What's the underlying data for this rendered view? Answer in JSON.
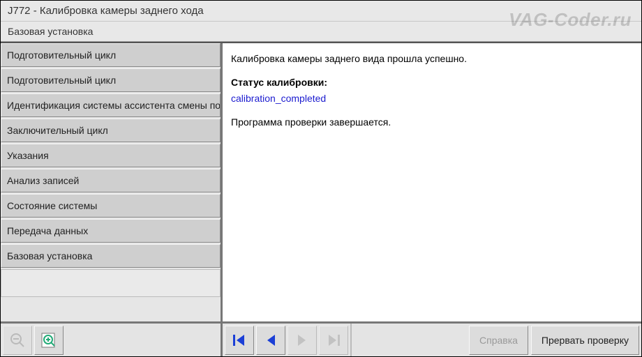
{
  "header": {
    "title": "J772 - Калибровка камеры заднего хода",
    "subtitle": "Базовая установка",
    "watermark": "VAG-Coder.ru"
  },
  "sidebar": {
    "items": [
      "Подготовительный цикл",
      "Подготовительный цикл",
      "Идентификация системы ассистента смены полосы движения",
      "Заключительный цикл",
      "Указания",
      "Анализ записей",
      "Состояние системы",
      "Передача данных",
      "Базовая установка"
    ]
  },
  "content": {
    "line1": "Калибровка камеры заднего вида прошла успешно.",
    "status_label": "Статус калибровки:",
    "status_value": "calibration_completed",
    "line2": "Программа проверки завершается."
  },
  "footer": {
    "help": "Справка",
    "abort": "Прервать проверку"
  },
  "colors": {
    "link": "#1b1bcf",
    "panel": "#e8e8e8",
    "button": "#cfcfcf"
  }
}
